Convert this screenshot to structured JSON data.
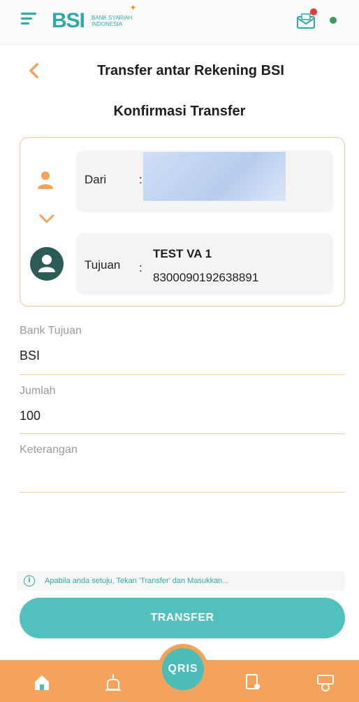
{
  "app": {
    "logo_text": "BSI",
    "logo_subtitle_line1": "BANK SYARIAH",
    "logo_subtitle_line2": "INDONESIA"
  },
  "header": {
    "title": "Transfer antar Rekening BSI",
    "subtitle": "Konfirmasi Transfer"
  },
  "transfer": {
    "from_label": "Dari",
    "to_label": "Tujuan",
    "separator": ":",
    "to_name": "TEST VA 1",
    "to_account": "8300090192638891"
  },
  "fields": {
    "bank_label": "Bank Tujuan",
    "bank_value": "BSI",
    "amount_label": "Jumlah",
    "amount_value": "100",
    "note_label": "Keterangan",
    "note_value": ""
  },
  "info": {
    "icon": "info-icon",
    "text": "Apabila anda setuju, Tekan 'Transfer' dan Masukkan..."
  },
  "actions": {
    "transfer_label": "TRANSFER"
  },
  "bottom_nav": {
    "qris_label": "QRIS"
  },
  "colors": {
    "primary_teal": "#2fa9a8",
    "button_teal": "#52c1bd",
    "accent_orange": "#f7a25a",
    "card_border": "#f4c79a"
  }
}
